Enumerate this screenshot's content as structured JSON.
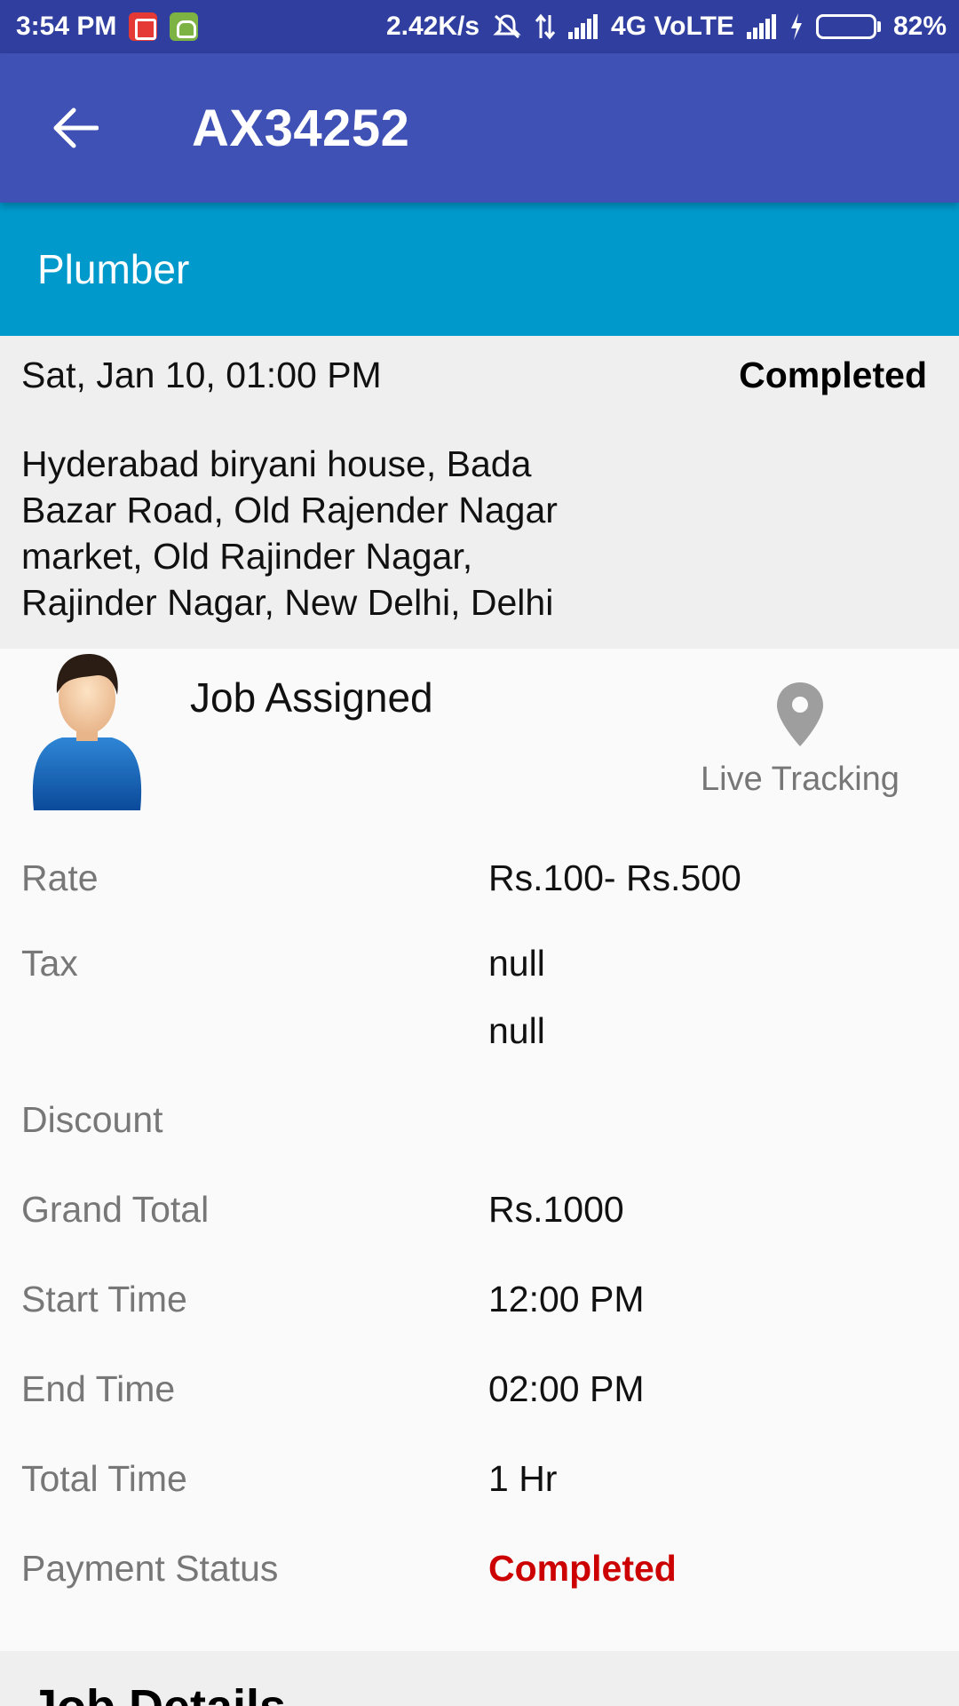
{
  "status_bar": {
    "time": "3:54 PM",
    "speed": "2.42K/s",
    "network": "4G VoLTE",
    "battery": "82%",
    "battery_level": 0.82,
    "icons": [
      "calculator-app-icon",
      "android-app-icon",
      "mute-icon",
      "data-arrows-icon",
      "signal-icon",
      "signal-icon",
      "charging-icon",
      "battery-icon"
    ]
  },
  "app_bar": {
    "title": "AX34252",
    "back_icon": "arrow-back-icon",
    "color": "#3f51b5"
  },
  "category": {
    "label": "Plumber",
    "color": "#0099cc"
  },
  "job": {
    "date": "Sat, Jan 10, 01:00 PM",
    "status": "Completed",
    "address": "Hyderabad biryani house, Bada Bazar Road, Old Rajender Nagar market, Old Rajinder Nagar, Rajinder Nagar, New Delhi, Delhi"
  },
  "assignment": {
    "label": "Job Assigned",
    "tracking_label": "Live Tracking",
    "tracking_icon": "location-pin-icon",
    "avatar_icon": "user-avatar-icon"
  },
  "details": {
    "rate_label": "Rate",
    "rate_value": "Rs.100- Rs.500",
    "tax_label": "Tax",
    "tax_value": "null",
    "tax_value_2": "null",
    "discount_label": "Discount",
    "discount_value": "",
    "grand_total_label": "Grand Total",
    "grand_total_value": "Rs.1000",
    "start_time_label": "Start Time",
    "start_time_value": "12:00 PM",
    "end_time_label": "End Time",
    "end_time_value": "02:00 PM",
    "total_time_label": "Total Time",
    "total_time_value": "1 Hr",
    "payment_status_label": "Payment Status",
    "payment_status_value": "Completed",
    "payment_status_color": "#cc0000"
  },
  "next_section": {
    "title": "Job Details"
  }
}
